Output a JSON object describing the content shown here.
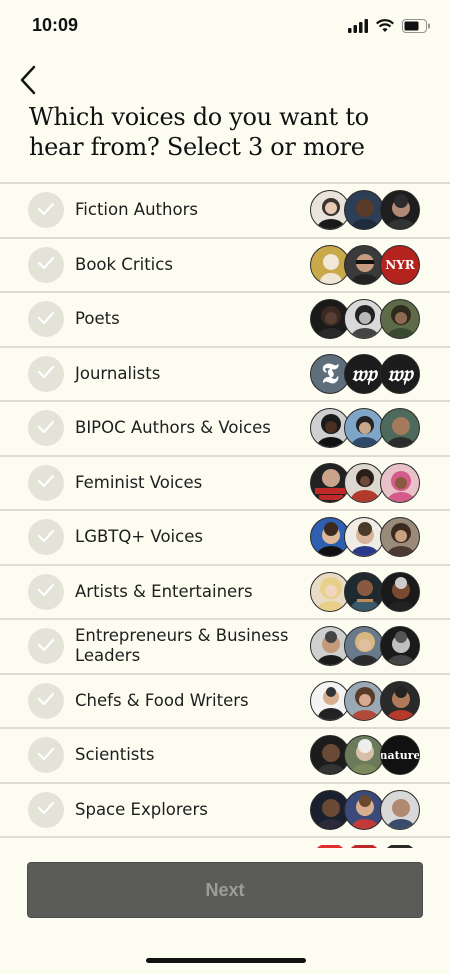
{
  "status": {
    "time": "10:09"
  },
  "colors": {
    "background": "#fdfcf0",
    "button": "#5b5b59",
    "button_text": "#9d9d98",
    "divider": "#dddcd0",
    "check_bg": "#e4e3d8"
  },
  "title": "Which voices do you want to hear from? Select 3 or more",
  "items": [
    {
      "label": "Fiction Authors"
    },
    {
      "label": "Book Critics",
      "avatar_text": "NYR"
    },
    {
      "label": "Poets"
    },
    {
      "label": "Journalists"
    },
    {
      "label": "BIPOC Authors & Voices"
    },
    {
      "label": "Feminist Voices"
    },
    {
      "label": "LGBTQ+ Voices"
    },
    {
      "label": "Artists & Entertainers"
    },
    {
      "label": "Entrepreneurs & Business Leaders"
    },
    {
      "label": "Chefs & Food Writers"
    },
    {
      "label": "Scientists",
      "avatar_text": "nature"
    },
    {
      "label": "Space Explorers"
    }
  ],
  "next_label": "Next"
}
